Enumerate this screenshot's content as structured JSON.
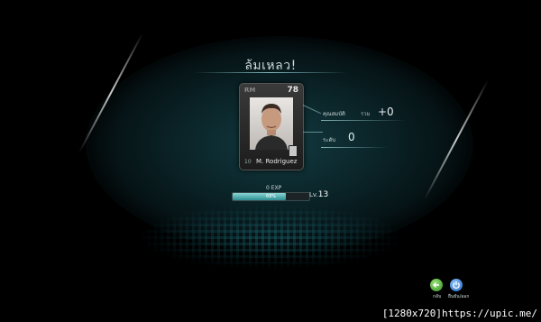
{
  "result": {
    "title": "ล้มเหลว!"
  },
  "card": {
    "position": "RM",
    "overall": "78",
    "player_name": "M. Rodriguez",
    "season_mark": "10"
  },
  "stats": {
    "attribute_label": "คุณสมบัติ",
    "attribute_sub": "รวม",
    "attribute_value": "+0",
    "level_label": "ระดับ",
    "level_value": "0"
  },
  "exp": {
    "label": "0 EXP",
    "percent_text": "69%",
    "progress": 0.69,
    "level_prefix": "Lv.",
    "level_number": "13"
  },
  "buttons": {
    "back_label": "กลับ",
    "quit_label": "ยืนยัน/ออก"
  },
  "watermark": "[1280x720]https://upic.me/",
  "colors": {
    "background": "#000000",
    "glow": "#123a40",
    "accent": "#2d8e91",
    "back_button": "#2f8d1d",
    "quit_button": "#1e62b8"
  }
}
